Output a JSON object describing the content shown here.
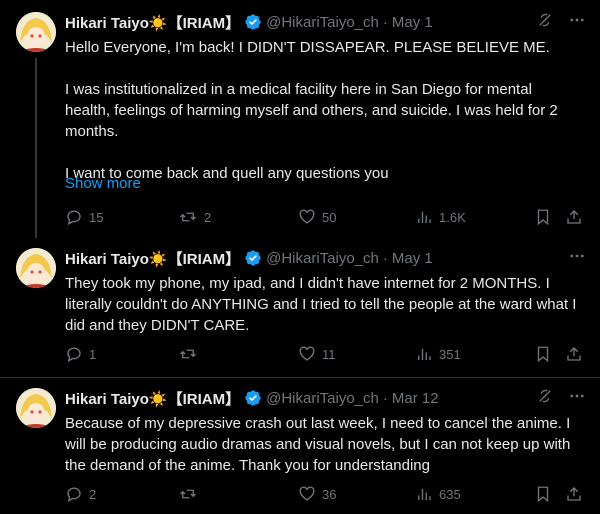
{
  "tweets": [
    {
      "name": "Hikari Taiyo☀️【IRIAM】",
      "handle": "@HikariTaiyo_ch",
      "separator": "·",
      "date": "May 1",
      "text": "Hello Everyone, I'm back! I DIDN'T DISSAPEAR. PLEASE BELIEVE ME.\n\nI was institutionalized in a medical facility here in San Diego for mental health, feelings of harming myself and others, and suicide. I was held for 2 months.\n\nI want to come back and quell any questions you",
      "show_more": "Show more",
      "replies": "15",
      "reposts": "2",
      "likes": "50",
      "views": "1.6K"
    },
    {
      "name": "Hikari Taiyo☀️【IRIAM】",
      "handle": "@HikariTaiyo_ch",
      "separator": "·",
      "date": "May 1",
      "text": "They took my phone, my ipad, and I didn't have internet for 2 MONTHS. I literally couldn't do ANYTHING and I tried to tell the people at the ward what I did and they DIDN'T CARE.",
      "replies": "1",
      "reposts": "",
      "likes": "11",
      "views": "351"
    },
    {
      "name": "Hikari Taiyo☀️【IRIAM】",
      "handle": "@HikariTaiyo_ch",
      "separator": "·",
      "date": "Mar 12",
      "text": "Because of my depressive crash out last week, I need to cancel the anime. I will be producing audio dramas and visual novels, but I can not keep up with the demand of the anime. Thank you for understanding",
      "replies": "2",
      "reposts": "",
      "likes": "36",
      "views": "635"
    }
  ],
  "colors": {
    "background": "#000000",
    "text": "#e7e9ea",
    "muted": "#71767b",
    "link": "#1d9bf0",
    "verified": "#1d9bf0",
    "divider": "#2f3336"
  }
}
